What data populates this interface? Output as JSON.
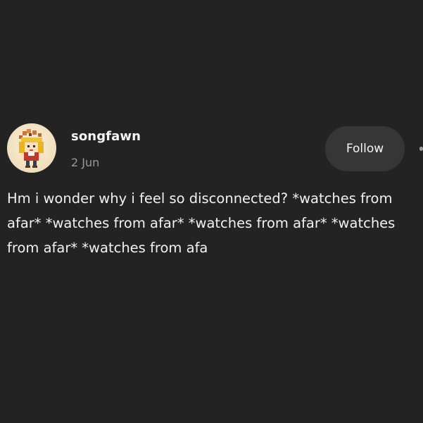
{
  "post": {
    "author": {
      "username": "songfawn",
      "date": "2 Jun",
      "avatar_icon": "pixel-art-avatar"
    },
    "follow_label": "Follow",
    "more_icon": "more-options-icon",
    "text": "Hm i wonder why i feel so disconnected? *watches from afar* *watches from afar* *watches from afar* *watches from afar* *watches from afa"
  },
  "colors": {
    "background": "#232324",
    "button_bg": "#363637",
    "text_primary": "#f2f2f2",
    "text_secondary": "#9a9a9a",
    "avatar_bg": "#f3e3c2"
  }
}
